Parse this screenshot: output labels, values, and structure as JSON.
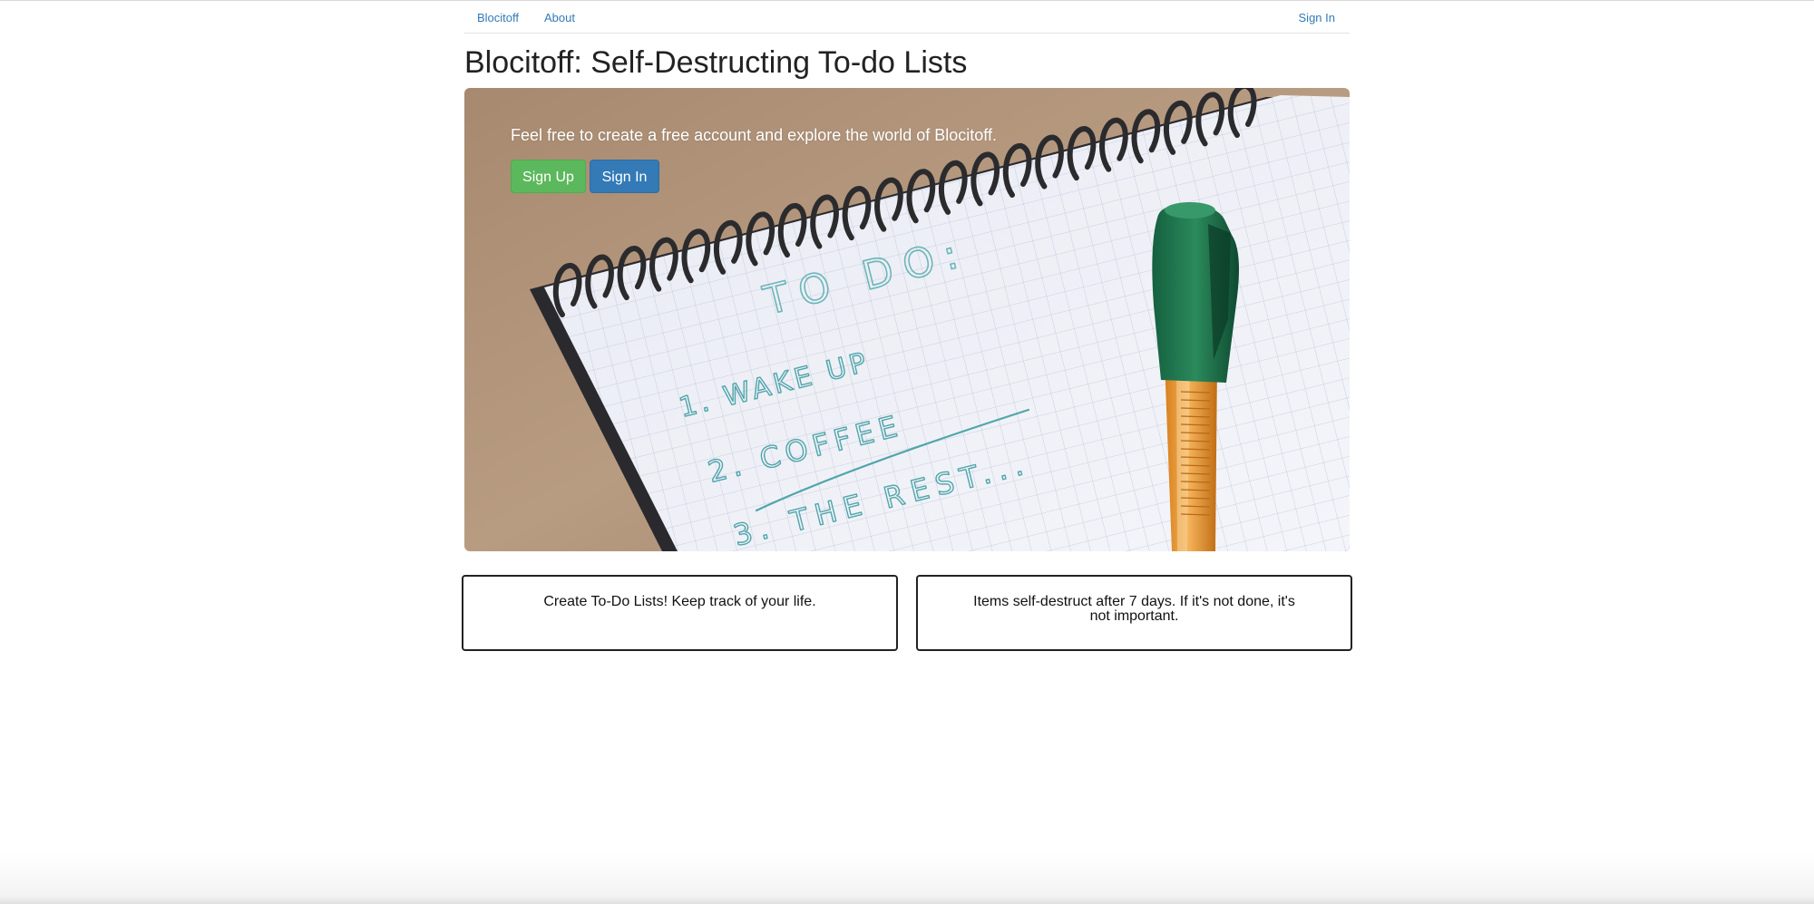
{
  "nav": {
    "brand": "Blocitoff",
    "about": "About",
    "sign_in": "Sign In"
  },
  "page": {
    "title": "Blocitoff: Self-Destructing To-do Lists"
  },
  "hero": {
    "tagline": "Feel free to create a free account and explore the world of Blocitoff.",
    "sign_up_label": "Sign Up",
    "sign_in_label": "Sign In",
    "notepad": {
      "heading": "TO DO:",
      "items": [
        {
          "num": "1.",
          "text": "WAKE UP"
        },
        {
          "num": "2.",
          "text": "COFFEE"
        },
        {
          "num": "3.",
          "text": "THE REST..."
        }
      ]
    }
  },
  "features": [
    {
      "text": "Create To-Do Lists! Keep track of your life."
    },
    {
      "text": "Items self-destruct after 7 days. If it's not done, it's not important."
    }
  ],
  "colors": {
    "link": "#337ab7",
    "success": "#5cb85c",
    "primary": "#337ab7"
  }
}
